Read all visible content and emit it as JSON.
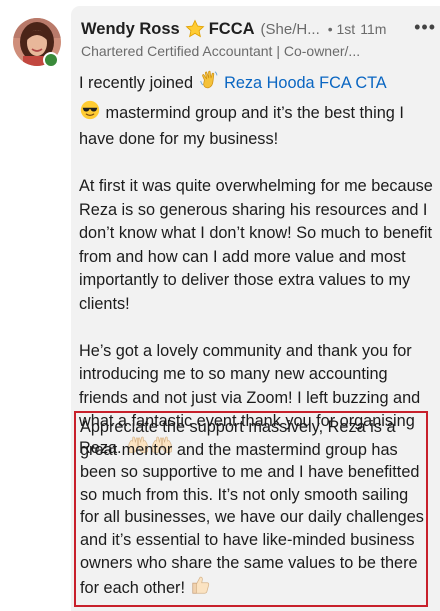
{
  "comment": {
    "author": {
      "name": "Wendy Ross",
      "credential": "FCCA",
      "pronouns": "(She/H...",
      "degree": "• 1st",
      "time": "11m",
      "headline": "Chartered Certified Accountant | Co-owner/...",
      "online_status_color": "#3a8a3a"
    },
    "more_label": "•••",
    "mention": "Reza Hooda FCA CTA",
    "p1_before": "I recently joined ",
    "p1_after": " mastermind group and it’s the best thing I have done for my business!",
    "p2": "At first it was quite overwhelming for me because Reza is so generous sharing his resources and I don’t know what I don’t know! So much to benefit from and how can I add more value and most importantly to deliver those extra values to my clients!",
    "p3": "He’s got a lovely community and thank you for introducing me to so many new accounting friends and not just via Zoom! I left buzzing and what a fantastic event thank you for organising Reza.",
    "p4": "Appreciate the support massively, Reza is a great mentor and the mastermind group has been so supportive to me and I have benefitted so much from this. It’s not only smooth sailing for all businesses, we have our daily challenges and it’s essential to have like-minded business owners who share the same values to be there for each other!",
    "emojis": [
      "star-emoji",
      "waving-hand-emoji",
      "sunglasses-emoji",
      "raising-hands-emoji",
      "raising-hands-emoji",
      "thumbs-up-emoji"
    ]
  },
  "colors": {
    "link": "#0a66c2",
    "highlight_border": "#c8202b",
    "card_background": "#f2f2f2"
  }
}
